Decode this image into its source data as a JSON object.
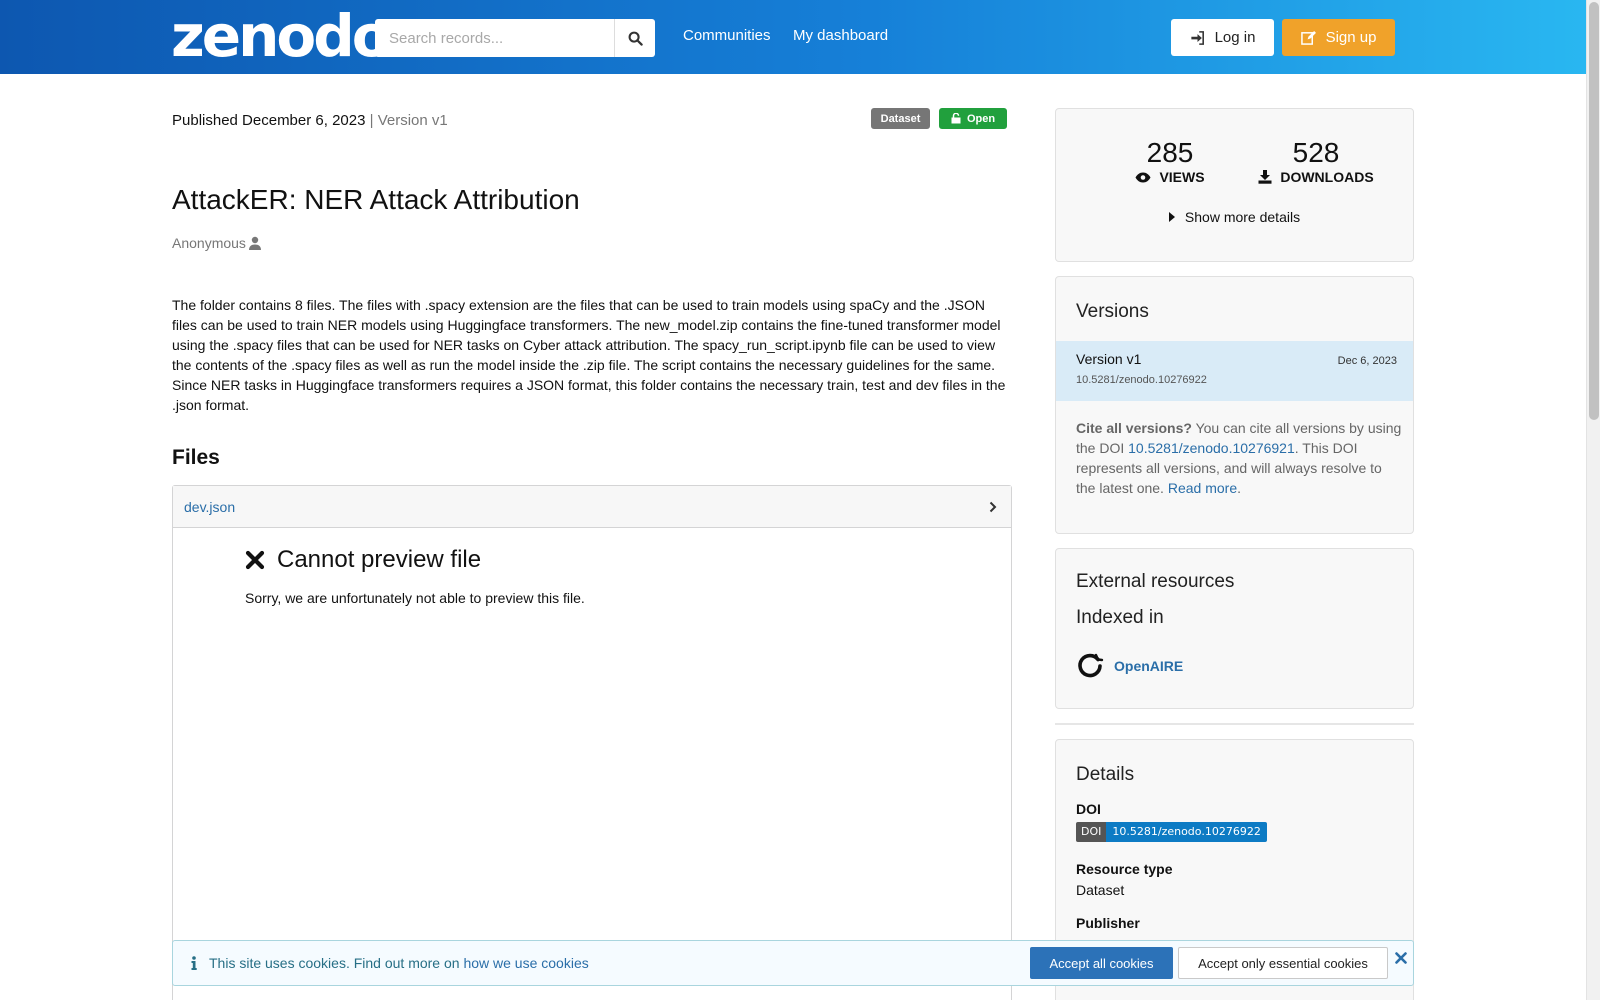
{
  "header": {
    "logo": "zenodo",
    "search_placeholder": "Search records...",
    "nav": [
      "Communities",
      "My dashboard"
    ],
    "login_label": "Log in",
    "signup_label": "Sign up"
  },
  "record": {
    "published": "Published December 6, 2023",
    "version": "| Version v1",
    "badges": [
      "Dataset",
      "Open"
    ],
    "title": "AttackER: NER Attack Attribution",
    "author": "Anonymous",
    "description": "The folder contains 8 files. The files with .spacy extension are the files that can be used to train models using spaCy and the .JSON files can be used to train NER models using Huggingface transformers. The new_model.zip contains the fine-tuned transformer model using the .spacy files that can be used for NER tasks on Cyber attack attribution. The spacy_run_script.ipynb file can be used to view the contents of the .spacy files as well as run the model inside the .zip file. The script contains the necessary guidelines for the same. Since NER tasks in Huggingface transformers requires a JSON format, this folder contains the necessary train, test and dev files in the .json format."
  },
  "files": {
    "heading": "Files",
    "current_file": "dev.json",
    "preview_error_title": "Cannot preview file",
    "preview_error_text": "Sorry, we are unfortunately not able to preview this file."
  },
  "stats": {
    "views": "285",
    "views_label": "VIEWS",
    "downloads": "528",
    "downloads_label": "DOWNLOADS",
    "more_label": "Show more details"
  },
  "versions": {
    "heading": "Versions",
    "items": [
      {
        "label": "Version v1",
        "date": "Dec 6, 2023",
        "doi": "10.5281/zenodo.10276922"
      }
    ],
    "cite_bold": "Cite all versions?",
    "cite_text1": " You can cite all versions by using the DOI ",
    "cite_doi": "10.5281/zenodo.10276921",
    "cite_text2": ". This DOI represents all versions, and will always resolve to the latest one. ",
    "cite_more": "Read more",
    "cite_end": "."
  },
  "external": {
    "heading": "External resources",
    "subheading": "Indexed in",
    "item": "OpenAIRE"
  },
  "details": {
    "heading": "Details",
    "doi_label": "DOI",
    "doi_badge_key": "DOI",
    "doi_badge_value": "10.5281/zenodo.10276922",
    "resource_type_label": "Resource type",
    "resource_type": "Dataset",
    "publisher_label": "Publisher"
  },
  "cookie": {
    "text": "This site uses cookies. Find out more on ",
    "link": "how we use cookies",
    "accept_all": "Accept all cookies",
    "accept_essential": "Accept only essential cookies"
  },
  "colors": {
    "header_start": "#0d57b0",
    "header_end": "#29b7f1",
    "signup": "#f0a22a",
    "open_badge": "#21a03d",
    "link": "#2a6ea8"
  }
}
